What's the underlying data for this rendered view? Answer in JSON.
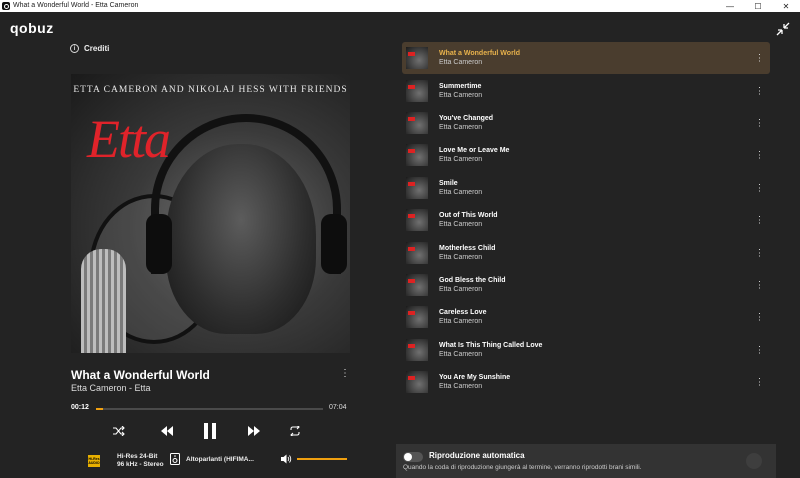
{
  "window": {
    "title": "What a Wonderful World - Etta Cameron",
    "minimize": "—",
    "maximize": "☐",
    "close": "✕"
  },
  "app": {
    "logo": "qobuz"
  },
  "credits": {
    "label": "Crediti"
  },
  "cover": {
    "top_text": "ETTA CAMERON AND NIKOLAJ HESS WITH FRIENDS",
    "title_text": "Etta"
  },
  "now_playing": {
    "title": "What a Wonderful World",
    "subtitle": "Etta Cameron - Etta",
    "menu": "⋮",
    "current_time": "00:12",
    "total_time": "07:04",
    "progress_fraction": 0.029
  },
  "quality": {
    "badge_line1": "Hi-Res",
    "badge_line2": "AUDIO",
    "line1": "Hi-Res 24-Bit",
    "line2": "96 kHz - Stereo"
  },
  "output": {
    "label": "Altoparlanti (HIFIMA..."
  },
  "volume": {
    "fraction": 1.0
  },
  "queue": {
    "items": [
      {
        "title": "What a Wonderful World",
        "artist": "Etta Cameron",
        "active": true,
        "menu": "⋮"
      },
      {
        "title": "Summertime",
        "artist": "Etta Cameron",
        "active": false,
        "menu": "⋮"
      },
      {
        "title": "You've Changed",
        "artist": "Etta Cameron",
        "active": false,
        "menu": "⋮"
      },
      {
        "title": "Love Me or Leave Me",
        "artist": "Etta Cameron",
        "active": false,
        "menu": "⋮"
      },
      {
        "title": "Smile",
        "artist": "Etta Cameron",
        "active": false,
        "menu": "⋮"
      },
      {
        "title": "Out of This World",
        "artist": "Etta Cameron",
        "active": false,
        "menu": "⋮"
      },
      {
        "title": "Motherless Child",
        "artist": "Etta Cameron",
        "active": false,
        "menu": "⋮"
      },
      {
        "title": "God Bless the Child",
        "artist": "Etta Cameron",
        "active": false,
        "menu": "⋮"
      },
      {
        "title": "Careless Love",
        "artist": "Etta Cameron",
        "active": false,
        "menu": "⋮"
      },
      {
        "title": "What Is This Thing Called Love",
        "artist": "Etta Cameron",
        "active": false,
        "menu": "⋮"
      },
      {
        "title": "You Are My Sunshine",
        "artist": "Etta Cameron",
        "active": false,
        "menu": "⋮"
      }
    ]
  },
  "autoplay": {
    "title": "Riproduzione automatica",
    "description": "Quando la coda di riproduzione giungerà al termine, verranno riprodotti brani simili.",
    "enabled": false
  },
  "colors": {
    "accent": "#f0a010",
    "active_row_bg": "#4a3d2e",
    "active_title": "#e8b24c",
    "background": "#232323",
    "hires_badge": "#e8b000"
  }
}
